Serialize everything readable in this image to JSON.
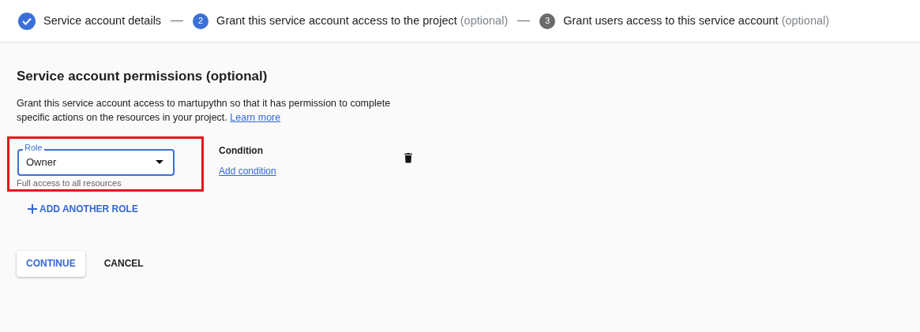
{
  "steps": [
    {
      "kind": "done",
      "label": "Service account details"
    },
    {
      "kind": "current",
      "number": "2",
      "label": "Grant this service account access to the project",
      "suffix": "(optional)"
    },
    {
      "kind": "pending",
      "number": "3",
      "label": "Grant users access to this service account",
      "suffix": "(optional)"
    }
  ],
  "section": {
    "title": "Service account permissions (optional)",
    "description": "Grant this service account access to martupythn so that it has permission to complete specific actions on the resources in your project.",
    "link": "Learn more"
  },
  "role_field": {
    "label": "Role",
    "value": "Owner",
    "helper": "Full access to all resources",
    "highlighted": true
  },
  "condition": {
    "title": "Condition",
    "link": "Add condition"
  },
  "add_role": "ADD ANOTHER ROLE",
  "buttons": [
    {
      "label": "CONTINUE",
      "kind": "raised"
    },
    {
      "label": "CANCEL",
      "kind": "text"
    }
  ]
}
